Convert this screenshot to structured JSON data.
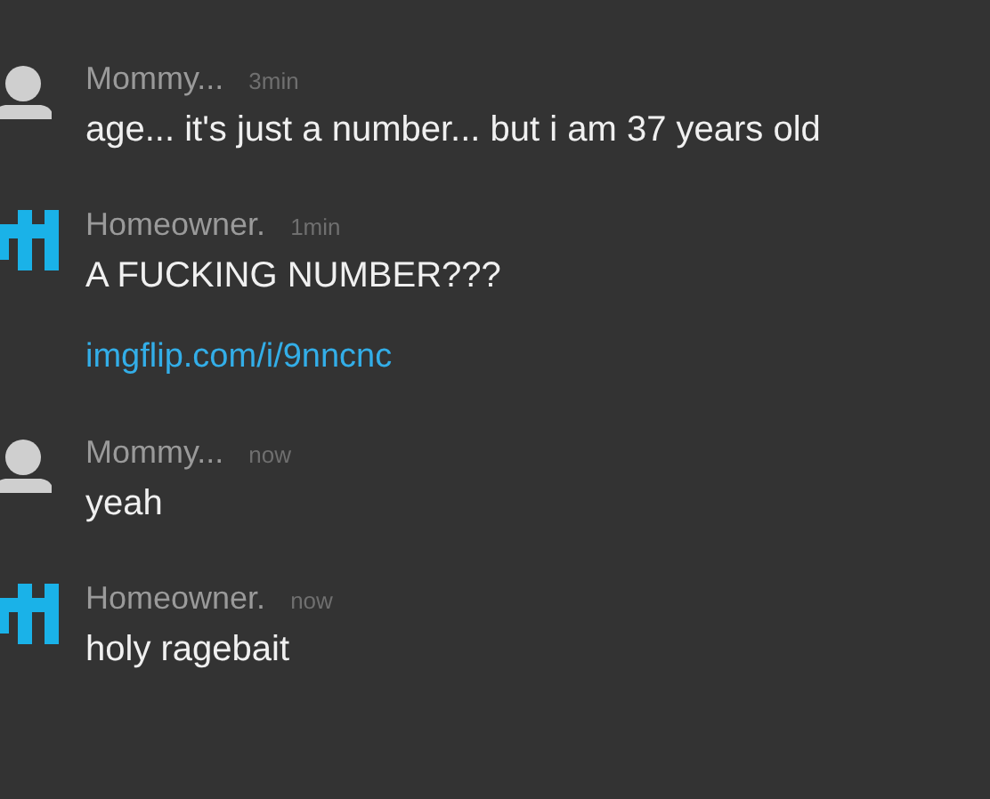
{
  "messages": [
    {
      "avatar": {
        "kind": "default"
      },
      "name": "Mommy...",
      "time": "3min",
      "lines": [
        {
          "kind": "text",
          "text": "age... it's just a number... but i am 37 years old"
        }
      ]
    },
    {
      "avatar": {
        "kind": "custom"
      },
      "name": "Homeowner.",
      "time": "1min",
      "lines": [
        {
          "kind": "text",
          "text": "A FUCKING NUMBER???"
        },
        {
          "kind": "link",
          "text": "imgflip.com/i/9nncnc"
        }
      ]
    },
    {
      "avatar": {
        "kind": "default"
      },
      "name": "Mommy...",
      "time": "now",
      "lines": [
        {
          "kind": "text",
          "text": "yeah"
        }
      ]
    },
    {
      "avatar": {
        "kind": "custom"
      },
      "name": "Homeowner.",
      "time": "now",
      "lines": [
        {
          "kind": "text",
          "text": "holy ragebait"
        }
      ]
    }
  ]
}
